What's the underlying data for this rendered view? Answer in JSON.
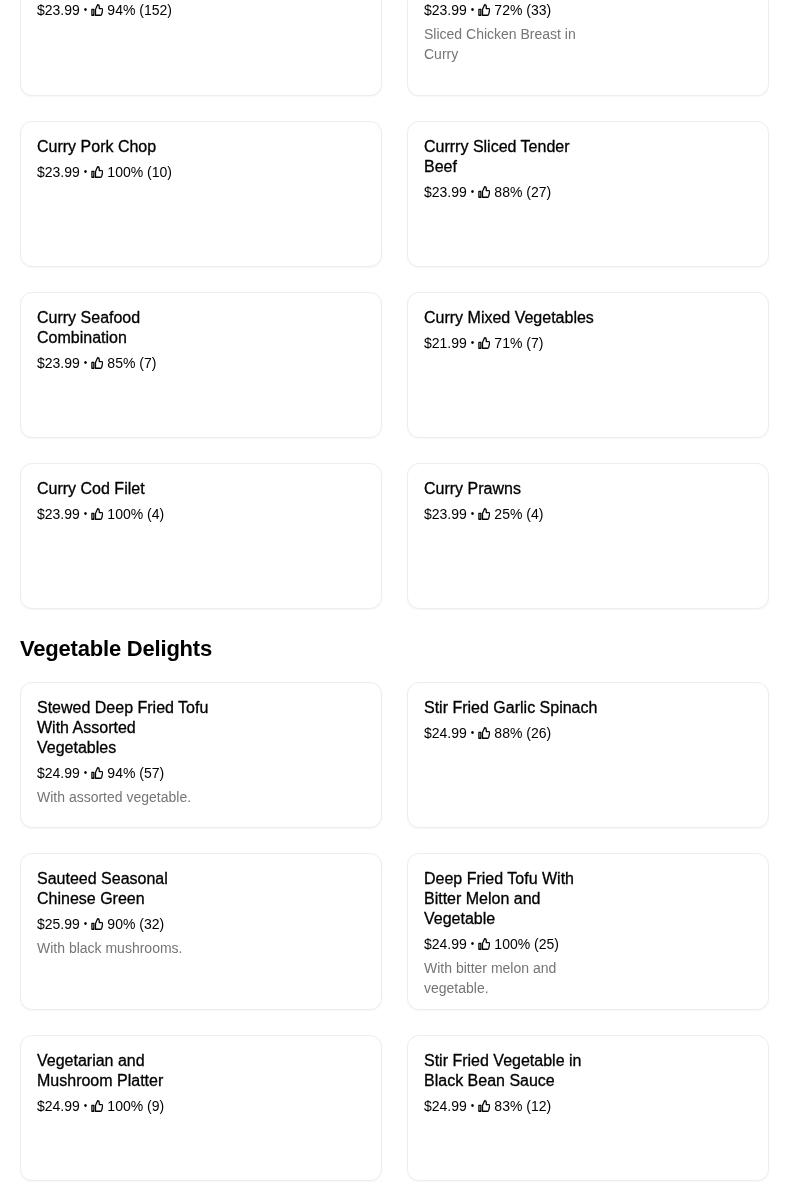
{
  "sections": [
    {
      "items": [
        {
          "price": "$23.99",
          "separator": "•",
          "rating": "94% (152)"
        },
        {
          "price": "$23.99",
          "separator": "•",
          "rating": "72% (33)",
          "description": "Sliced Chicken Breast in Curry"
        },
        {
          "title": "Curry Pork Chop",
          "price": "$23.99",
          "separator": "•",
          "rating": "100% (10)"
        },
        {
          "title": "Currry Sliced Tender Beef",
          "price": "$23.99",
          "separator": "•",
          "rating": "88% (27)"
        },
        {
          "title": "Curry Seafood Combination",
          "price": "$23.99",
          "separator": "•",
          "rating": "85% (7)"
        },
        {
          "title": "Curry Mixed Vegetables",
          "price": "$21.99",
          "separator": "•",
          "rating": "71% (7)"
        },
        {
          "title": "Curry Cod Filet",
          "price": "$23.99",
          "separator": "•",
          "rating": "100% (4)"
        },
        {
          "title": "Curry Prawns",
          "price": "$23.99",
          "separator": "•",
          "rating": "25% (4)"
        }
      ]
    },
    {
      "title": "Vegetable Delights",
      "items": [
        {
          "title": "Stewed Deep Fried Tofu With Assorted Vegetables",
          "price": "$24.99",
          "separator": "•",
          "rating": "94% (57)",
          "description": "With assorted vegetable."
        },
        {
          "title": "Stir Fried Garlic Spinach",
          "price": "$24.99",
          "separator": "•",
          "rating": "88% (26)"
        },
        {
          "title": "Sauteed Seasonal Chinese Green",
          "price": "$25.99",
          "separator": "•",
          "rating": "90% (32)",
          "description": "With black mushrooms."
        },
        {
          "title": "Deep Fried Tofu With Bitter Melon and Vegetable",
          "price": "$24.99",
          "separator": "•",
          "rating": "100% (25)",
          "description": "With bitter melon and vegetable."
        },
        {
          "title": "Vegetarian and Mushroom Platter",
          "price": "$24.99",
          "separator": "•",
          "rating": "100% (9)"
        },
        {
          "title": "Stir Fried Vegetable in Black Bean Sauce",
          "price": "$24.99",
          "separator": "•",
          "rating": "83% (12)"
        }
      ]
    }
  ]
}
